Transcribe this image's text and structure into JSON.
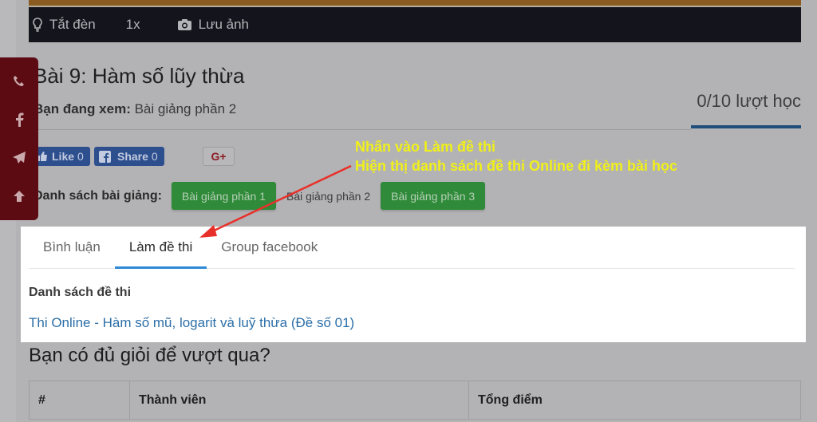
{
  "video_controls": {
    "light_label": "Tắt đèn",
    "speed_label": "1x",
    "save_label": "Lưu ảnh"
  },
  "social_bar": {
    "items": [
      "phone-icon",
      "facebook-icon",
      "telegram-icon",
      "arrow-up-icon"
    ]
  },
  "lesson": {
    "title": "Bài 9: Hàm số lũy thừa",
    "viewing_label": "Bạn đang xem:",
    "viewing_value": "Bài giảng phần 2",
    "progress_text": "0/10 lượt học",
    "progress_fraction": 0
  },
  "share": {
    "like_label": "Like",
    "like_count": "0",
    "share_label": "Share",
    "share_count": "0",
    "gplus_label": "G+"
  },
  "lectures": {
    "label": "Danh sách bài giảng:",
    "items": [
      {
        "label": "Bài giảng phần 1",
        "state": "link"
      },
      {
        "label": "Bài giảng phần 2",
        "state": "current"
      },
      {
        "label": "Bài giảng phần 3",
        "state": "link"
      }
    ]
  },
  "annotation": {
    "line1": "Nhấn vào Làm đề thi",
    "line2": "Hiện thị danh sách đề thi Online đi kèm bài học",
    "arrow_color": "#e8302a",
    "text_color": "#f0f01a"
  },
  "tabs": {
    "items": [
      {
        "label": "Bình luận",
        "active": false
      },
      {
        "label": "Làm đề thi",
        "active": true
      },
      {
        "label": "Group facebook",
        "active": false
      }
    ]
  },
  "exams": {
    "heading": "Danh sách đề thi",
    "items": [
      "Thi Online - Hàm số mũ, logarit và luỹ thừa (Đề số 01)"
    ]
  },
  "ranking": {
    "title": "Bạn có đủ giỏi để vượt qua?",
    "columns": [
      "#",
      "Thành viên",
      "Tổng điểm"
    ]
  }
}
